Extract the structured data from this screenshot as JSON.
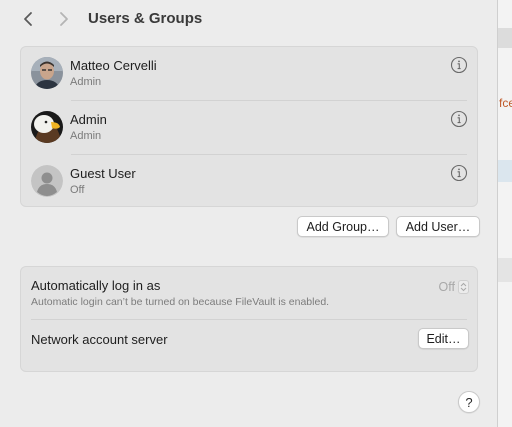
{
  "toolbar": {
    "title": "Users & Groups",
    "back_icon": "chevron-left-icon",
    "forward_icon": "chevron-right-icon"
  },
  "users": [
    {
      "name": "Matteo Cervelli",
      "role": "Admin",
      "avatar": "photo-avatar"
    },
    {
      "name": "Admin",
      "role": "Admin",
      "avatar": "eagle-avatar"
    },
    {
      "name": "Guest User",
      "role": "Off",
      "avatar": "generic-person-avatar"
    }
  ],
  "buttons": {
    "add_group": "Add Group…",
    "add_user": "Add User…"
  },
  "login": {
    "auto_login_label": "Automatically log in as",
    "auto_login_value": "Off",
    "auto_login_note": "Automatic login can’t be turned on because FileVault is enabled.",
    "network_server_label": "Network account server",
    "edit_button": "Edit…"
  },
  "help": {
    "label": "?"
  },
  "background_window": {
    "text_fragment": "fce"
  },
  "colors": {
    "window_bg": "#ececec",
    "group_bg": "#e3e3e3",
    "text_primary": "#1e1e1e",
    "text_secondary": "#7a7a7a"
  }
}
